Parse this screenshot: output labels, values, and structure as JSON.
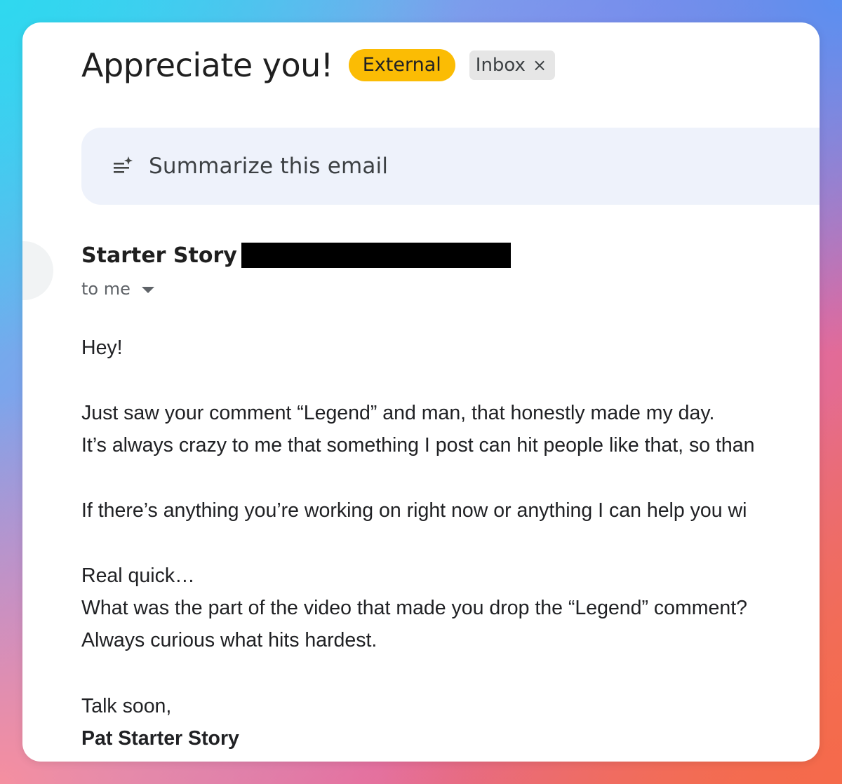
{
  "email": {
    "subject": "Appreciate you!",
    "labels": {
      "external": "External",
      "inbox": "Inbox",
      "inbox_remove": "×"
    },
    "summarize_label": "Summarize this email",
    "sender_name": "Starter Story",
    "recipient": "to me",
    "body": {
      "greeting": "Hey!",
      "p1_line1": "Just saw your comment “Legend” and man, that honestly made my day.",
      "p1_line2": "It’s always crazy to me that something I post can hit people like that, so than",
      "p2_line1": "If there’s anything you’re working on right now or anything I can help you wi",
      "p3_line1": "Real quick…",
      "p3_line2": "What was the part of the video that made you drop the “Legend” comment?",
      "p3_line3": "Always curious what hits hardest.",
      "signoff": "Talk soon,",
      "signature": "Pat Starter Story"
    }
  },
  "colors": {
    "external_chip": "#fbbc04",
    "inbox_chip": "#e6e6e6",
    "summarize_bg": "#eef2fb",
    "text": "#202124",
    "muted": "#5f6368"
  },
  "icons": {
    "summarize": "summarize-sparkle-icon",
    "recipient_expand": "caret-down-icon"
  }
}
